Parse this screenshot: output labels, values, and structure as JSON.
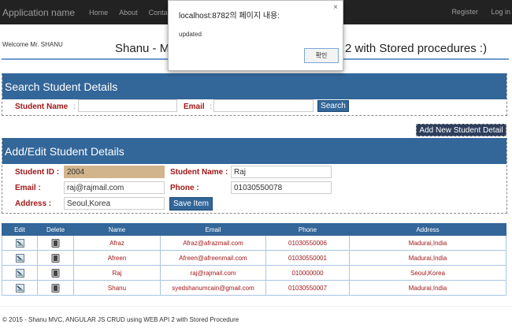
{
  "nav": {
    "brand": "Application name",
    "links": [
      "Home",
      "About",
      "Contact"
    ],
    "right": [
      "Register",
      "Log in"
    ]
  },
  "welcome": "Welcome Mr. SHANU",
  "title": {
    "left_visible": "Shanu - MV",
    "right_visible": "2 with Stored procedures :)"
  },
  "search": {
    "header": "Search Student Details",
    "name_label": "Student Name",
    "email_label": "Email",
    "colon": ":",
    "name_value": "",
    "email_value": "",
    "button": "Search"
  },
  "add_new_button": "Add New Student Detail",
  "edit": {
    "header": "Add/Edit Student Details",
    "id_label": "Student ID :",
    "id_value": "2004",
    "name_label": "Student Name :",
    "name_value": "Raj",
    "email_label": "Email :",
    "email_value": "raj@rajmail.com",
    "phone_label": "Phone :",
    "phone_value": "01030550078",
    "address_label": "Address :",
    "address_value": "Seoul,Korea",
    "save_button": "Save Item"
  },
  "table": {
    "headers": [
      "Edit",
      "Delete",
      "Name",
      "Email",
      "Phone",
      "Address"
    ],
    "rows": [
      {
        "name": "Afraz",
        "email": "Afraz@afrazmail.com",
        "phone": "01030550006",
        "address": "Madurai,India"
      },
      {
        "name": "Afreen",
        "email": "Afreen@afreenmail.com",
        "phone": "01030550001",
        "address": "Madurai,India"
      },
      {
        "name": "Raj",
        "email": "raj@rajmail.com",
        "phone": "010000000",
        "address": "Seoul,Korea"
      },
      {
        "name": "Shanu",
        "email": "syedshanumcain@gmail.com",
        "phone": "01030550007",
        "address": "Madurai,India"
      }
    ]
  },
  "footer": "© 2015 - Shanu MVC, ANGULAR JS CRUD using WEB API 2 with Stored Procedure",
  "dialog": {
    "title": "localhost:8782의 페이지 내용:",
    "close": "×",
    "message": "updated",
    "ok": "확인"
  }
}
